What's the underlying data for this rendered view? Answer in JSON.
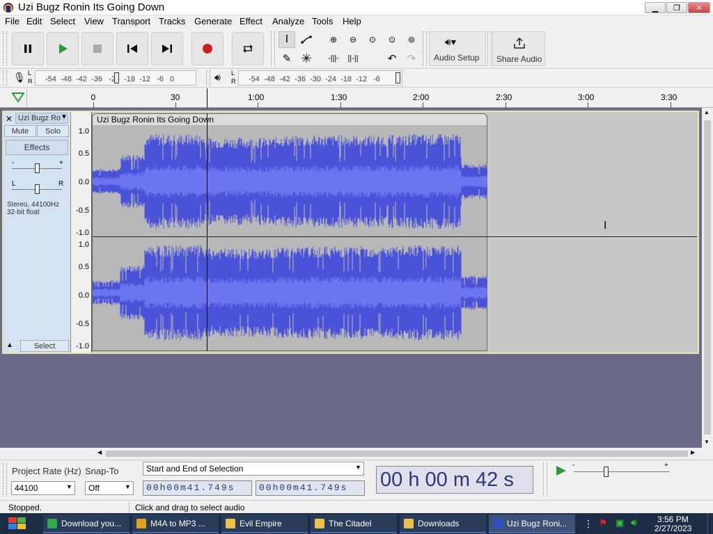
{
  "window": {
    "title": "Uzi Bugz Ronin Its Going Down"
  },
  "menu": [
    "File",
    "Edit",
    "Select",
    "View",
    "Transport",
    "Tracks",
    "Generate",
    "Effect",
    "Analyze",
    "Tools",
    "Help"
  ],
  "toolbar": {
    "audio_setup": "Audio Setup",
    "share_audio": "Share Audio"
  },
  "meters": {
    "record_scale": "-54  -48  -42  -36   -24  -18  -12   -6   0",
    "play_scale": "-54  -48  -42  -36  -30  -24  -18  -12   -6",
    "l": "L",
    "r": "R"
  },
  "timeline": {
    "labels": [
      "0",
      "30",
      "1:00",
      "1:30",
      "2:00",
      "2:30",
      "3:00",
      "3:30"
    ]
  },
  "track": {
    "name": "Uzi Bugz Ro",
    "clip_name": "Uzi Bugz Ronin Its Going Down",
    "mute": "Mute",
    "solo": "Solo",
    "effects": "Effects",
    "gain_minus": "-",
    "gain_plus": "+",
    "pan_l": "L",
    "pan_r": "R",
    "info_line1": "Stereo, 44100Hz",
    "info_line2": "32-bit float",
    "select": "Select",
    "scale": [
      "1.0",
      "0.5",
      "0.0",
      "-0.5",
      "-1.0"
    ]
  },
  "bottom": {
    "project_rate_label": "Project Rate (Hz)",
    "snap_to_label": "Snap-To",
    "project_rate_value": "44100",
    "snap_value": "Off",
    "selection_mode": "Start and End of Selection",
    "sel_start": "00h00m41.749s",
    "sel_end": "00h00m41.749s",
    "big_time": "00 h 00 m 42 s"
  },
  "status": {
    "left": "Stopped.",
    "middle": "Click and drag to select audio"
  },
  "taskbar": {
    "items": [
      {
        "label": "Download you...",
        "color": "#2fa84f"
      },
      {
        "label": "M4A to MP3 ...",
        "color": "#e0a020"
      },
      {
        "label": "Evil Empire",
        "color": "#e8c050"
      },
      {
        "label": "The Citadel",
        "color": "#e8c050"
      },
      {
        "label": "Downloads",
        "color": "#e8c050"
      },
      {
        "label": "Uzi Bugz Roni...",
        "color": "#3050c0"
      }
    ],
    "time": "3:56 PM",
    "date": "2/27/2023"
  },
  "colors": {
    "waveform": "#4a52d8",
    "waveform_dark": "#2a30b0",
    "track_bg": "#c8c8c8"
  }
}
